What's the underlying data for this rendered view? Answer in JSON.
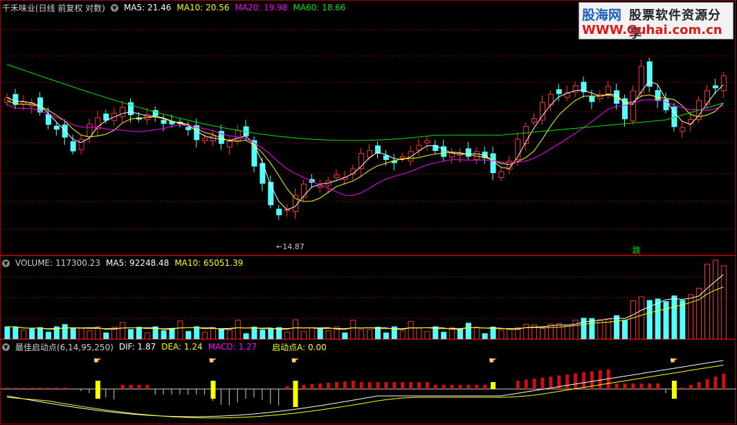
{
  "main": {
    "title": "千禾味业(日线 前复权 对数)",
    "ma5": "MA5: 21.46",
    "ma10": "MA10: 20.56",
    "ma20": "MA20: 19.98",
    "ma60": "MA60: 18.66",
    "low_label": "14.87",
    "signal_label": "跌"
  },
  "volume": {
    "title": "VOLUME: 117300.23",
    "ma5": "MA5: 92248.48",
    "ma10": "MA10: 65051.39"
  },
  "indicator": {
    "title": "最佳启动点(6,14,95,250)",
    "dif": "DIF: 1.87",
    "dea": "DEA: 1.24",
    "macd": "MACD: 1.27",
    "start": "启动点A: 0.00"
  },
  "watermark": {
    "line1a": "股海网",
    "line1b": "股票软件资源分享",
    "line2": "WWW.Guhai.com.cn"
  },
  "colors": {
    "up": "#ff3232",
    "down": "#54ffff",
    "ma5": "#ffffff",
    "ma10": "#ffff00",
    "ma20": "#ff00ff",
    "ma60": "#00e600",
    "grid": "#8a0000"
  },
  "icons": [
    "chevron-down-icon",
    "hand-pointer-icon"
  ]
}
